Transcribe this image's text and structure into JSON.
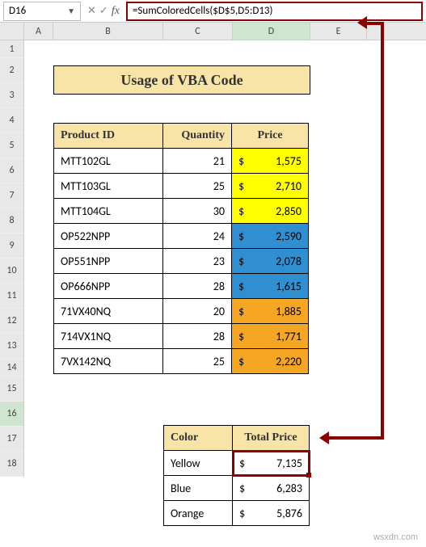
{
  "name_box": "D16",
  "formula": "=SumColoredCells($D$5,D5:D13)",
  "columns": [
    "A",
    "B",
    "C",
    "D",
    "E"
  ],
  "rows": [
    "1",
    "2",
    "3",
    "4",
    "5",
    "6",
    "7",
    "8",
    "9",
    "10",
    "11",
    "12",
    "13",
    "14",
    "15",
    "16",
    "17",
    "18"
  ],
  "active_col": "D",
  "active_row": "16",
  "title": "Usage of VBA Code",
  "table": {
    "headers": {
      "id": "Product ID",
      "qty": "Quantity",
      "price": "Price"
    },
    "rows": [
      {
        "id": "MTT102GL",
        "qty": "21",
        "price": "1,575",
        "color": "yellow"
      },
      {
        "id": "MTT103GL",
        "qty": "25",
        "price": "2,710",
        "color": "yellow"
      },
      {
        "id": "MTT104GL",
        "qty": "30",
        "price": "2,850",
        "color": "yellow"
      },
      {
        "id": "OP522NPP",
        "qty": "24",
        "price": "2,590",
        "color": "blue"
      },
      {
        "id": "OP551NPP",
        "qty": "23",
        "price": "2,078",
        "color": "blue"
      },
      {
        "id": "OP666NPP",
        "qty": "28",
        "price": "1,615",
        "color": "blue"
      },
      {
        "id": "71VX40NQ",
        "qty": "20",
        "price": "1,885",
        "color": "orange"
      },
      {
        "id": "714VX1NQ",
        "qty": "28",
        "price": "1,771",
        "color": "orange"
      },
      {
        "id": "7VX142NQ",
        "qty": "25",
        "price": "2,220",
        "color": "orange"
      }
    ]
  },
  "summary": {
    "headers": {
      "color": "Color",
      "total": "Total Price"
    },
    "rows": [
      {
        "color": "Yellow",
        "total": "7,135",
        "highlight": true
      },
      {
        "color": "Blue",
        "total": "6,283",
        "highlight": false
      },
      {
        "color": "Orange",
        "total": "5,876",
        "highlight": false
      }
    ]
  },
  "currency": "$",
  "watermark": "wsxdn.com"
}
